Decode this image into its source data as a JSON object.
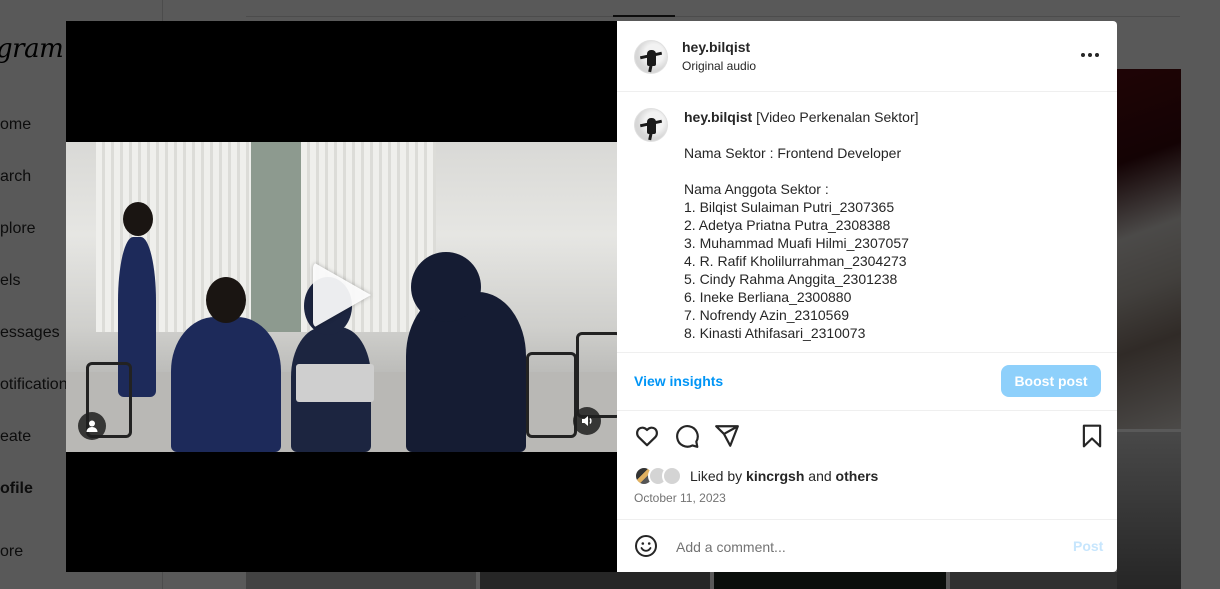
{
  "background": {
    "logo_text": "gram",
    "nav_items": [
      {
        "label": "ome",
        "bold": false
      },
      {
        "label": "arch",
        "bold": false
      },
      {
        "label": "plore",
        "bold": false
      },
      {
        "label": "els",
        "bold": false
      },
      {
        "label": "essages",
        "bold": false
      },
      {
        "label": "otifications",
        "bold": false
      },
      {
        "label": "eate",
        "bold": false
      },
      {
        "label": "ofile",
        "bold": true
      },
      {
        "label": "ore",
        "bold": false
      }
    ]
  },
  "post": {
    "header": {
      "username": "hey.bilqist",
      "audio": "Original audio",
      "more_icon": "more-horizontal-icon"
    },
    "caption": {
      "username": "hey.bilqist",
      "text": " [Video Perkenalan Sektor]\n\nNama Sektor : Frontend Developer\n\nNama Anggota Sektor :\n1. Bilqist Sulaiman Putri_2307365\n2. Adetya Priatna Putra_2308388\n3. Muhammad Muafi Hilmi_2307057\n4. R. Rafif Kholilurrahman_2304273\n5. Cindy Rahma Anggita_2301238\n6. Ineke Berliana_2300880\n7. Nofrendy Azin_2310569\n8. Kinasti Athifasari_2310073"
    },
    "insights_label": "View insights",
    "boost_label": "Boost post",
    "likes": {
      "prefix": "Liked by",
      "user": "kincrgsh",
      "and": "and",
      "others": "others"
    },
    "date": "October 11, 2023",
    "comment": {
      "placeholder": "Add a comment...",
      "post_label": "Post"
    },
    "colors": {
      "link": "#0095f6",
      "boost_disabled": "#8ed0fb",
      "post_disabled": "#c7e6fd"
    }
  }
}
